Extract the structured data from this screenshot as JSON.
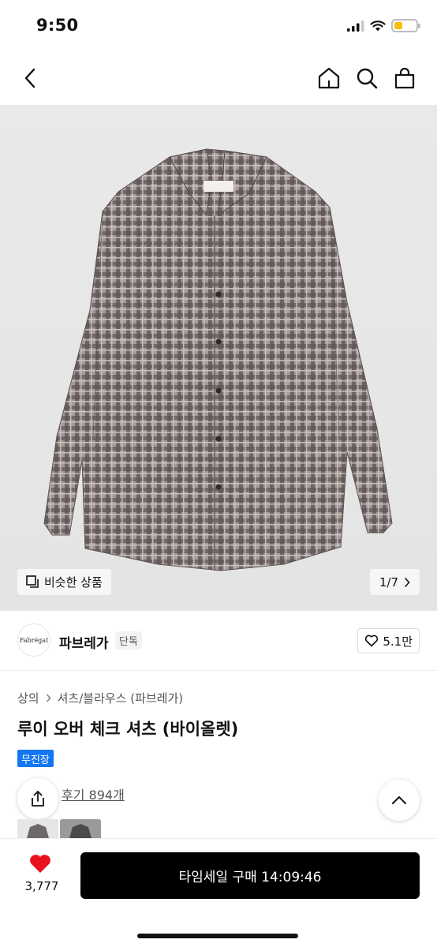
{
  "status_bar": {
    "time": "9:50"
  },
  "hero": {
    "similar_label": "비슷한 상품",
    "pager": "1/7"
  },
  "brand": {
    "logo_text": "Fabrégat",
    "name": "파브레가",
    "tag": "단독",
    "like_count": "5.1만"
  },
  "product": {
    "breadcrumb": [
      "상의",
      "셔츠/블라우스 (파브레가)"
    ],
    "title": "루이 오버 체크 셔츠 (바이올렛)",
    "badge": "무진장",
    "review_text": "후기 894개"
  },
  "bottom": {
    "like_count": "3,777",
    "buy_label": "타임세일 구매 14:09:46"
  },
  "colors": {
    "accent": "#1477f2",
    "heart": "#e8121f",
    "buy_button": "#000000"
  },
  "icons": [
    "back-icon",
    "home-icon",
    "search-icon",
    "cart-icon",
    "similar-icon",
    "chevron-right-icon",
    "heart-outline-icon",
    "share-icon",
    "chevron-up-icon",
    "heart-filled-icon"
  ]
}
